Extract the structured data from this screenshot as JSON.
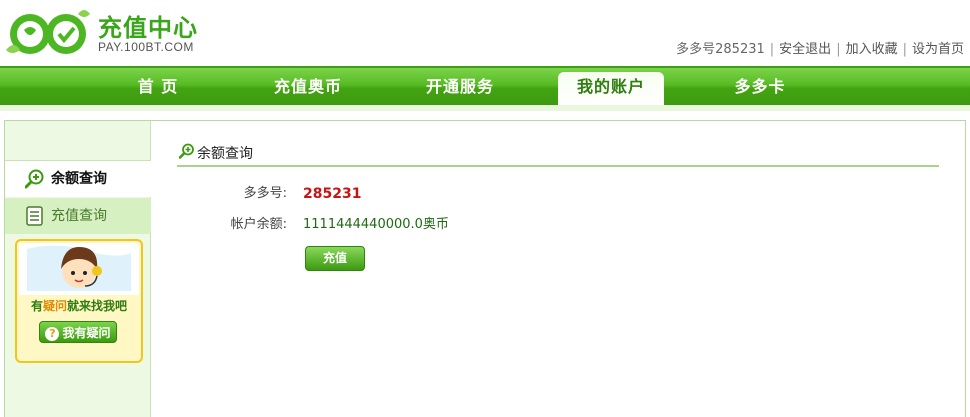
{
  "brand": {
    "logo_text": "bt",
    "title": "充值中心",
    "subtitle": "PAY.100BT.COM",
    "logo_colors": [
      "#39a51a",
      "#ffffff"
    ]
  },
  "top_links": {
    "user_id": "多多号285231",
    "logout": "安全退出",
    "favorite": "加入收藏",
    "homepage": "设为首页"
  },
  "nav": {
    "items": [
      {
        "label": "首 页"
      },
      {
        "label": "充值奥币"
      },
      {
        "label": "开通服务"
      },
      {
        "label": "我的账户",
        "active": true
      },
      {
        "label": "多多卡"
      }
    ]
  },
  "sidebar": {
    "items": [
      {
        "label": "余额查询",
        "icon": "magnifier-plus-icon",
        "active": true
      },
      {
        "label": "充值查询",
        "icon": "document-list-icon"
      }
    ],
    "help_card": {
      "text_a": "有",
      "text_b": "疑问",
      "text_c": "就来找我吧",
      "button_label": "我有疑问",
      "button_icon": "?"
    }
  },
  "main": {
    "section_title": "余额查询",
    "section_icon": "magnifier-plus-icon",
    "rows": [
      {
        "label": "多多号:",
        "value": "285231"
      },
      {
        "label": "帐户余额:",
        "value": "1111444440000.0奥币"
      }
    ],
    "recharge_button": "充值"
  },
  "colors": {
    "accent_green": "#43a412",
    "highlight_red": "#cc1111",
    "help_yellow": "#f2c51a"
  }
}
